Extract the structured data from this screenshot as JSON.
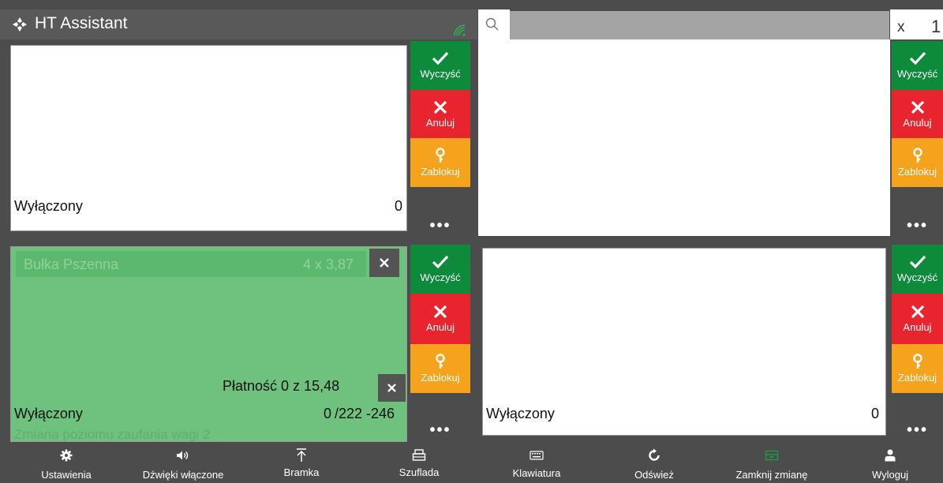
{
  "app": {
    "title": "HT Assistant"
  },
  "search": {
    "placeholder": "",
    "qty_prefix": "x",
    "qty_value": "1"
  },
  "side_buttons": {
    "clear": "Wyczyść",
    "cancel": "Anuluj",
    "lock": "Zablokuj",
    "more": "•••"
  },
  "panels": {
    "top_left": {
      "status": "Wyłączony",
      "count": "0"
    },
    "bottom_left": {
      "item_name": "Bułka Pszenna",
      "item_qty": "4 x 3,87",
      "payment": "Płatność 0 z 15,48",
      "status": "Wyłączony",
      "count": "0",
      "weight": "/222 -246",
      "trust_message": "Zmiana poziomu zaufania wagi 2"
    },
    "bottom_right": {
      "status": "Wyłączony",
      "count": "0"
    }
  },
  "toolbar": {
    "settings": "Ustawienia",
    "sounds": "Dźwięki włączone",
    "gate": "Bramka",
    "drawer": "Szuflada",
    "keyboard": "Klawiatura",
    "refresh": "Odśwież",
    "close_shift": "Zamknij zmianę",
    "logout": "Wyloguj"
  },
  "colors": {
    "accept": "#0d8a3a",
    "cancel": "#e8242e",
    "lock": "#f5a21c",
    "active_panel": "#6ec27e",
    "background": "#4c4c4c"
  }
}
